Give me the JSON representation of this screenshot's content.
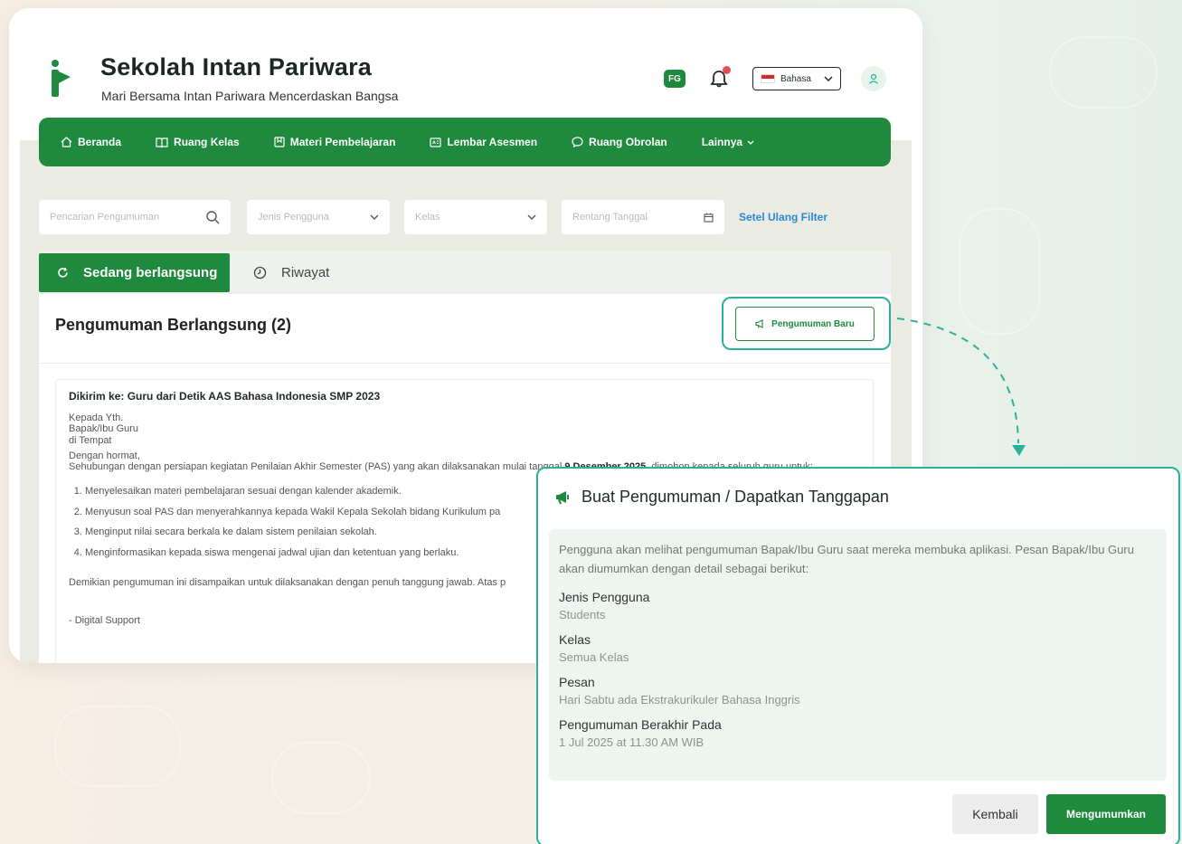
{
  "brand": {
    "title": "Sekolah Intan Pariwara",
    "subtitle": "Mari Bersama Intan Pariwara Mencerdaskan Bangsa",
    "fg_badge": "FG"
  },
  "header": {
    "language": "Bahasa"
  },
  "nav": [
    {
      "label": "Beranda",
      "icon": "home-icon"
    },
    {
      "label": "Ruang Kelas",
      "icon": "book-icon"
    },
    {
      "label": "Materi Pembelajaran",
      "icon": "material-icon"
    },
    {
      "label": "Lembar Asesmen",
      "icon": "assessment-icon"
    },
    {
      "label": "Ruang Obrolan",
      "icon": "chat-icon"
    },
    {
      "label": "Lainnya",
      "icon": "chevron-down-icon"
    }
  ],
  "filters": {
    "search_placeholder": "Pencarian Pengumuman",
    "user_type_placeholder": "Jenis Pengguna",
    "class_placeholder": "Kelas",
    "date_placeholder": "Rentang Tanggal",
    "reset": "Setel Ulang Filter"
  },
  "tabs": {
    "active": "Sedang berlangsung",
    "history": "Riwayat"
  },
  "list": {
    "title": "Pengumuman Berlangsung (2)",
    "new_button": "Pengumuman Baru"
  },
  "announcement": {
    "sent_to": "Dikirim ke: Guru dari Detik AAS Bahasa Indonesia SMP 2023",
    "salutation": [
      "Kepada Yth.",
      "Bapak/Ibu Guru",
      "di Tempat",
      "Dengan hormat,"
    ],
    "intro_before": "Sehubungan dengan persiapan kegiatan Penilaian Akhir Semester (PAS) yang akan dilaksanakan mulai tanggal ",
    "intro_date": "9 Desember 2025",
    "intro_after": ", dimohon kepada seluruh guru untuk:",
    "items": [
      "Menyelesaikan materi pembelajaran sesuai dengan kalender akademik.",
      "Menyusun soal PAS dan menyerahkannya kepada Wakil Kepala Sekolah bidang Kurikulum pa",
      "Menginput nilai secara berkala ke dalam sistem penilaian sekolah.",
      "Menginformasikan kepada siswa mengenai jadwal ujian dan ketentuan yang berlaku."
    ],
    "closing": "Demikian pengumuman ini disampaikan untuk dilaksanakan dengan penuh tanggung jawab. Atas p",
    "signature": "- Digital Support"
  },
  "dialog": {
    "title": "Buat Pengumuman / Dapatkan Tanggapan",
    "intro": "Pengguna akan melihat pengumuman Bapak/Ibu Guru saat mereka membuka aplikasi. Pesan Bapak/Ibu Guru akan diumumkan dengan detail sebagai berikut:",
    "fields": [
      {
        "label": "Jenis Pengguna",
        "value": "Students"
      },
      {
        "label": "Kelas",
        "value": "Semua Kelas"
      },
      {
        "label": "Pesan",
        "value": "Hari Sabtu ada Ekstrakurikuler Bahasa Inggris"
      },
      {
        "label": "Pengumuman Berakhir Pada",
        "value": "1 Jul 2025 at 11.30 AM WIB"
      }
    ],
    "back": "Kembali",
    "submit": "Mengumumkan"
  },
  "colors": {
    "brand_green": "#1f8a3e",
    "highlight_teal": "#2bb19a",
    "link_blue": "#2f86d6"
  }
}
